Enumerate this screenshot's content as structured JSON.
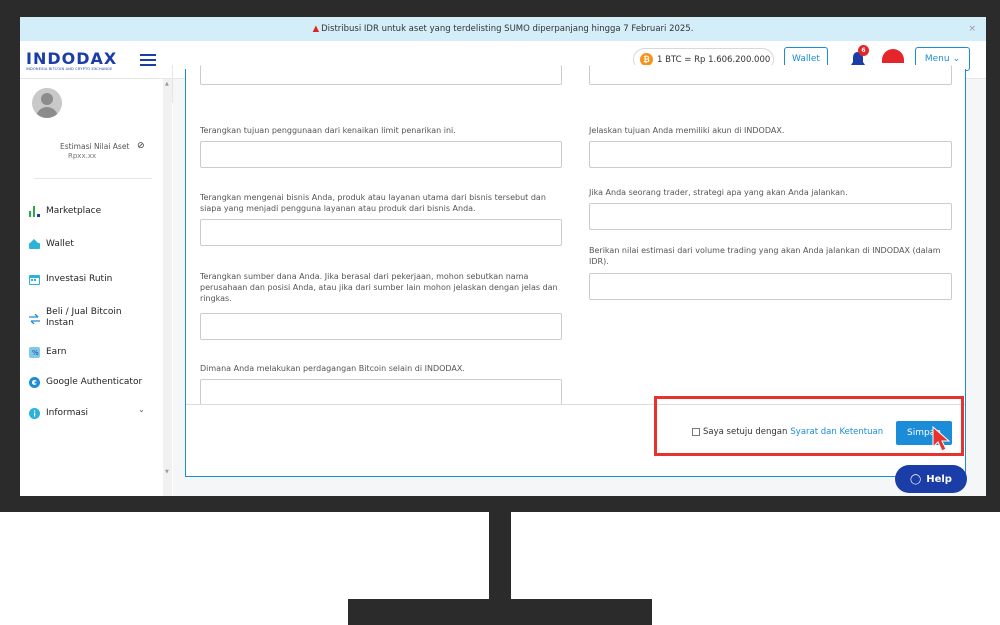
{
  "banner": {
    "text": "Distribusi IDR untuk aset yang terdelisting SUMO diperpanjang hingga 7 Februari 2025.",
    "close": "×"
  },
  "header": {
    "logo": "INDODAX",
    "logo_sub": "INDONESIA BITCOIN AND CRYPTO EXCHANGE",
    "btc_symbol": "₿",
    "btc_price": "1 BTC = Rp 1.606.200.000",
    "wallet_label": "Wallet",
    "notification_count": "6",
    "menu_label": "Menu"
  },
  "sidebar": {
    "estimasi_label": "Estimasi Nilai Aset",
    "estimasi_value": "Rpxx.xx",
    "items": [
      {
        "label": "Marketplace",
        "icon": "chart-bars-icon"
      },
      {
        "label": "Wallet",
        "icon": "wallet-icon"
      },
      {
        "label": "Investasi Rutin",
        "icon": "calendar-icon"
      },
      {
        "label": "Beli / Jual Bitcoin Instan",
        "icon": "swap-arrows-icon"
      },
      {
        "label": "Earn",
        "icon": "earn-icon"
      },
      {
        "label": "Google Authenticator",
        "icon": "google-icon"
      },
      {
        "label": "Informasi",
        "icon": "info-icon"
      }
    ]
  },
  "form": {
    "q_left_1": "Terangkan tujuan penggunaan dari kenaikan limit penarikan ini.",
    "q_left_2": "Terangkan mengenai bisnis Anda, produk atau layanan utama dari bisnis tersebut dan siapa yang menjadi pengguna layanan atau produk dari bisnis Anda.",
    "q_left_3": "Terangkan sumber dana Anda. Jika berasal dari pekerjaan, mohon sebutkan nama perusahaan dan posisi Anda, atau jika dari sumber lain mohon jelaskan dengan jelas dan ringkas.",
    "q_left_4": "Dimana Anda melakukan perdagangan Bitcoin selain di INDODAX.",
    "q_right_1": "Jelaskan tujuan Anda memiliki akun di INDODAX.",
    "q_right_2": "Jika Anda seorang trader, strategi apa yang akan Anda jalankan.",
    "q_right_3": "Berikan nilai estimasi dari volume trading yang akan Anda jalankan di INDODAX (dalam IDR).",
    "agree_text": "Saya setuju dengan",
    "agree_link": "Syarat dan Ketentuan",
    "save_label": "Simpan"
  },
  "help": {
    "label": "Help"
  },
  "colors": {
    "brand": "#1a3da8",
    "accent": "#1a8cd8",
    "highlight": "#e7332d"
  }
}
